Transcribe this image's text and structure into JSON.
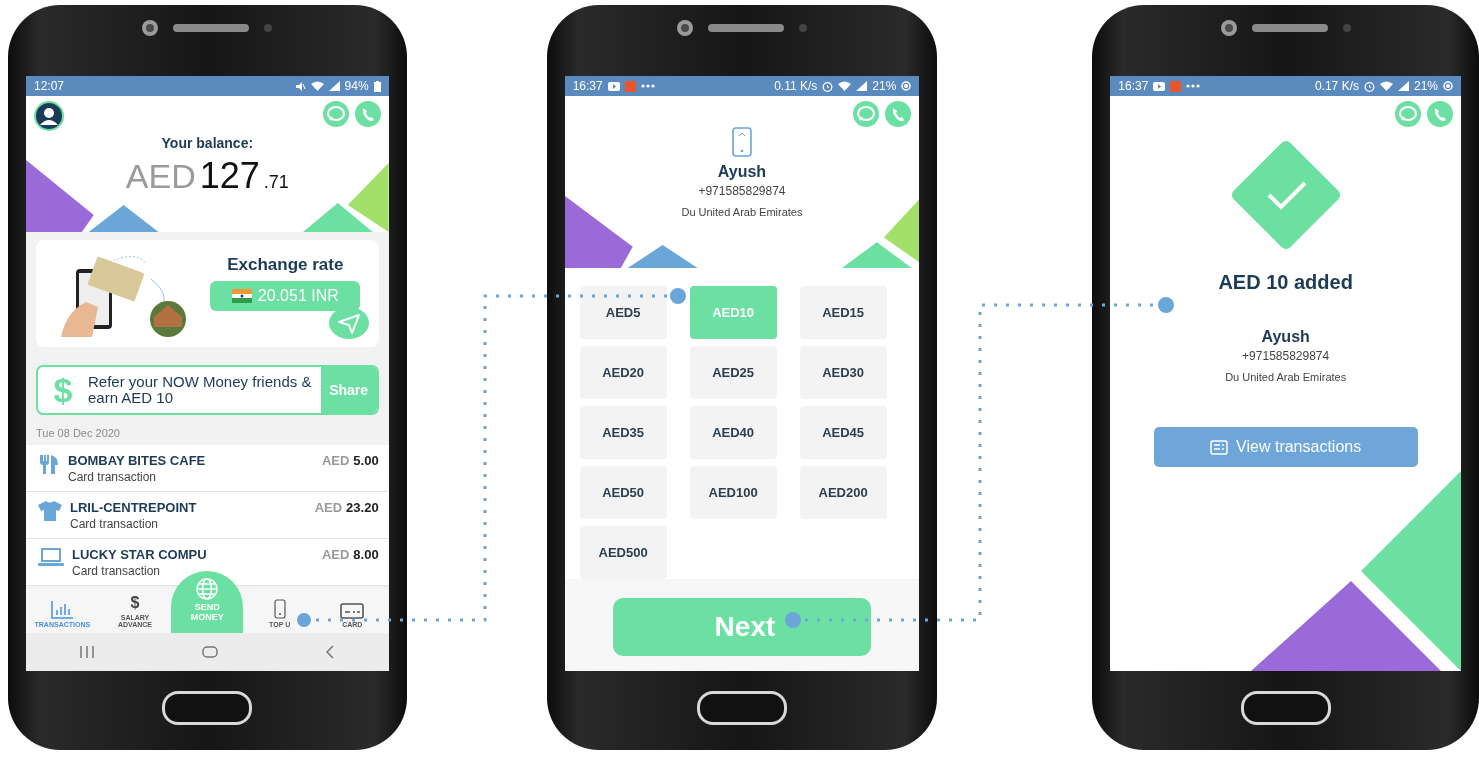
{
  "balance_screen": {
    "status_bar": {
      "time": "12:07",
      "battery": "94%"
    },
    "balance": {
      "label": "Your balance:",
      "currency": "AED",
      "whole": "127",
      "fraction": ".71"
    },
    "exchange": {
      "title": "Exchange rate",
      "rate": "20.051 INR"
    },
    "refer": {
      "icon": "$",
      "text": "Refer your NOW Money friends & earn AED 10",
      "button": "Share"
    },
    "date": "Tue 08 Dec 2020",
    "transactions": [
      {
        "kind": "food",
        "name": "BOMBAY BITES CAFE",
        "subtitle": "Card transaction",
        "currency": "AED",
        "amount": "5.00"
      },
      {
        "kind": "clothing",
        "name": "LRIL-CENTREPOINT",
        "subtitle": "Card transaction",
        "currency": "AED",
        "amount": "23.20"
      },
      {
        "kind": "laptop",
        "name": "LUCKY STAR COMPU",
        "subtitle": "Card transaction",
        "currency": "AED",
        "amount": "8.00"
      }
    ],
    "nav": [
      {
        "kind": "chart",
        "label": "TRANSACTIONS",
        "selected": true
      },
      {
        "kind": "dollar",
        "glyph": "$",
        "label": "SALARY ADVANCE",
        "selected": false
      },
      {
        "kind": "send",
        "label": "SEND MONEY",
        "selected": false
      },
      {
        "kind": "phone",
        "label": "TOP U",
        "selected": false
      },
      {
        "kind": "card",
        "label": "CARD",
        "selected": false
      }
    ]
  },
  "top_up_screen": {
    "status_bar": {
      "time": "16:37",
      "speed": "0.11 K/s",
      "battery": "21%"
    },
    "contact": {
      "name": "Ayush",
      "phone": "+971585829874",
      "carrier": "Du United Arab Emirates"
    },
    "amounts": [
      {
        "label": "AED5",
        "selected": false
      },
      {
        "label": "AED10",
        "selected": true
      },
      {
        "label": "AED15",
        "selected": false
      },
      {
        "label": "AED20",
        "selected": false
      },
      {
        "label": "AED25",
        "selected": false
      },
      {
        "label": "AED30",
        "selected": false
      },
      {
        "label": "AED35",
        "selected": false
      },
      {
        "label": "AED40",
        "selected": false
      },
      {
        "label": "AED45",
        "selected": false
      },
      {
        "label": "AED50",
        "selected": false
      },
      {
        "label": "AED100",
        "selected": false
      },
      {
        "label": "AED200",
        "selected": false
      },
      {
        "label": "AED500",
        "selected": false
      }
    ],
    "next_button": "Next"
  },
  "confirmation_screen": {
    "status_bar": {
      "time": "16:37",
      "speed": "0.17 K/s",
      "battery": "21%"
    },
    "message": "AED 10 added",
    "contact": {
      "name": "Ayush",
      "phone": "+971585829874",
      "carrier": "Du United Arab Emirates"
    },
    "button": "View transactions"
  }
}
